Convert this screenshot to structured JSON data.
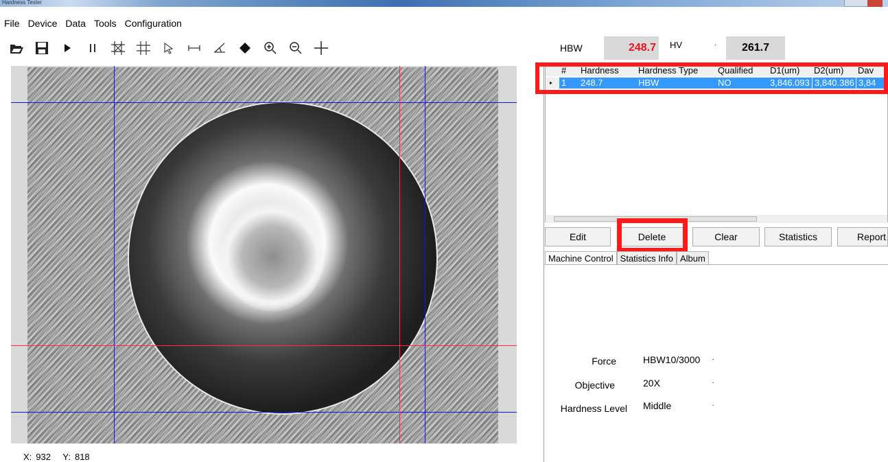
{
  "window": {
    "title": "Hardness Tester"
  },
  "menu": [
    "File",
    "Device",
    "Data",
    "Tools",
    "Configuration"
  ],
  "toolbar": [
    {
      "name": "open-folder-icon"
    },
    {
      "name": "save-icon"
    },
    {
      "name": "play-icon"
    },
    {
      "name": "pause-icon"
    },
    {
      "name": "auto-measure-icon"
    },
    {
      "name": "grid-icon"
    },
    {
      "name": "select-pointer-icon"
    },
    {
      "name": "measure-distance-icon"
    },
    {
      "name": "measure-angle-icon"
    },
    {
      "name": "eraser-icon"
    },
    {
      "name": "zoom-in-icon"
    },
    {
      "name": "zoom-out-icon"
    },
    {
      "name": "crosshair-icon"
    }
  ],
  "status": {
    "x_label": "X:",
    "x_value": "932",
    "y_label": "Y:",
    "y_value": "818"
  },
  "readout": {
    "hbw_label": "HBW",
    "hbw_value": "248.7",
    "hv_select": "HV",
    "hv_value": "261.7"
  },
  "table": {
    "headers": [
      "#",
      "Hardness",
      "Hardness Type",
      "Qualified",
      "D1(um)",
      "D2(um)",
      "Dav"
    ],
    "rows": [
      [
        "1",
        "248.7",
        "HBW",
        "NO",
        "3,846.093",
        "3,840.386",
        "3,84"
      ]
    ]
  },
  "actions": {
    "edit": "Edit",
    "delete": "Delete",
    "clear": "Clear",
    "statistics": "Statistics",
    "report": "Report"
  },
  "tabs": [
    "Machine Control",
    "Statistics Info",
    "Album"
  ],
  "machine": {
    "force_label": "Force",
    "force_value": "HBW10/3000",
    "objective_label": "Objective",
    "objective_value": "20X",
    "level_label": "Hardness Level",
    "level_value": "Middle"
  },
  "colors": {
    "selection": "#3399ff",
    "highlight": "#ff1a1a",
    "hbw_value": "#e8141e"
  }
}
